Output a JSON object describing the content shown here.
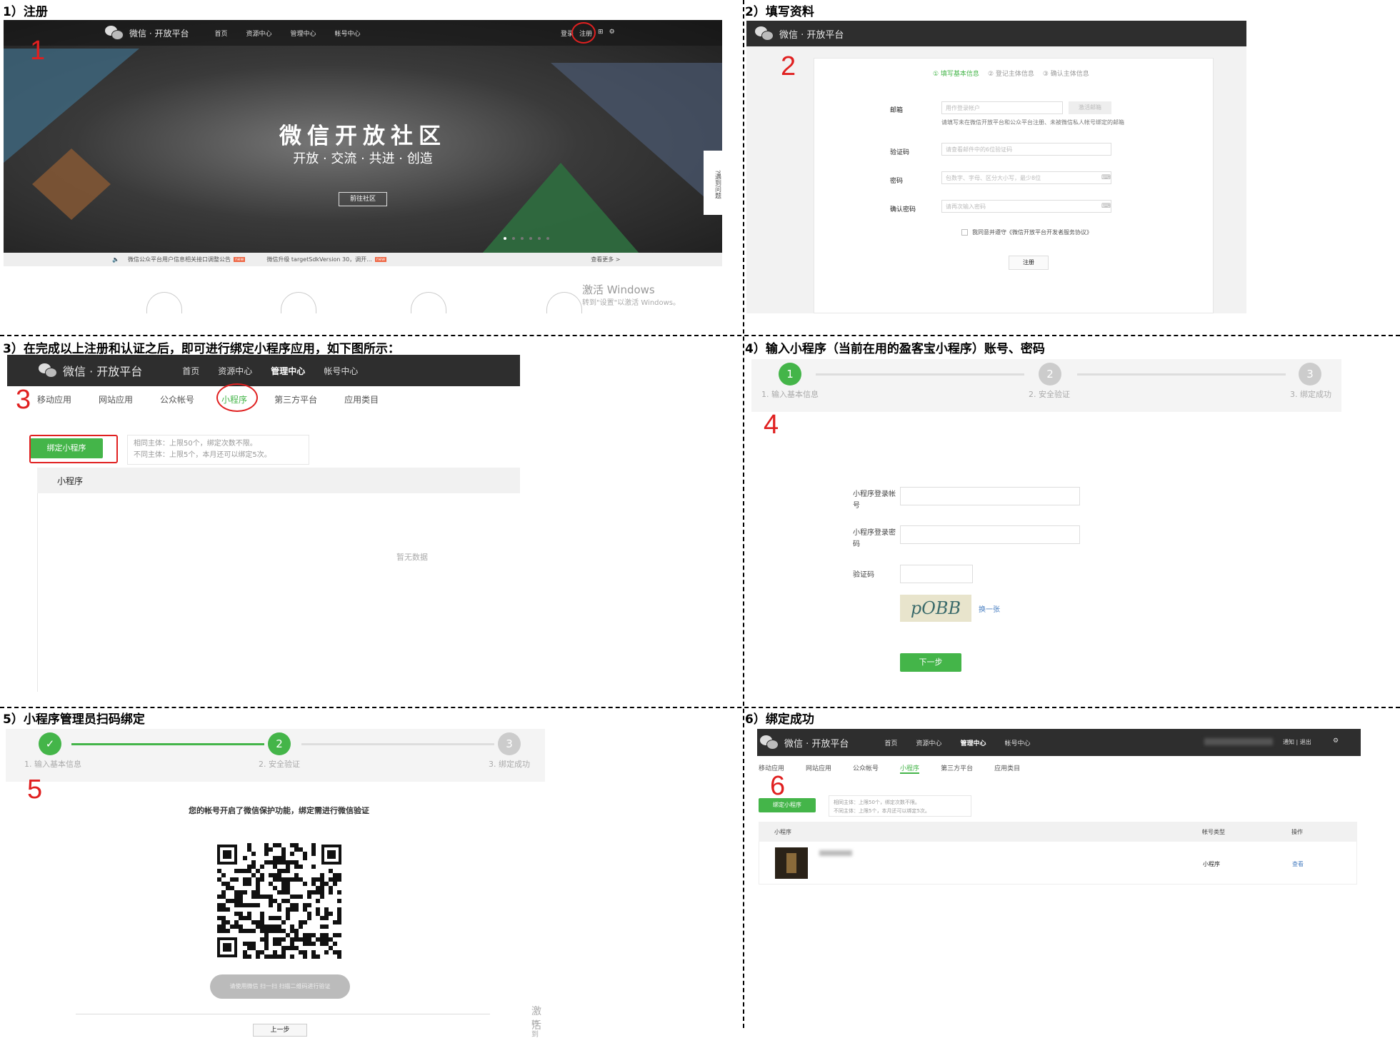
{
  "captions": {
    "c1": "1）注册",
    "c2": "2）填写资料",
    "c3": "3）在完成以上注册和认证之后，即可进行绑定小程序应用，如下图所示：",
    "c4": "4）输入小程序（当前在用的盈客宝小程序）账号、密码",
    "c5": "5）小程序管理员扫码绑定",
    "c6": "6）绑定成功"
  },
  "markers": {
    "m1": "1",
    "m2": "2",
    "m3": "3",
    "m4": "4",
    "m5": "5",
    "m6": "6"
  },
  "brand": "微信 · 开放平台",
  "nav": {
    "home": "首页",
    "resources": "资源中心",
    "manage": "管理中心",
    "account": "帐号中心"
  },
  "shot1": {
    "login": "登录",
    "register": "注册",
    "hero_title": "微信开放社区",
    "hero_sub": "开放 · 交流 · 共进 · 创造",
    "hero_btn": "前往社区",
    "notice1": "微信公众平台用户信息相关接口调整公告",
    "notice2": "微信升级 targetSdkVersion 30，调开...",
    "more": "查看更多 >",
    "side": "遇到问题",
    "new_badge": "new",
    "win1": "激活 Windows",
    "win2": "转到\"设置\"以激活 Windows。"
  },
  "shot2": {
    "steps": [
      "① 填写基本信息",
      "② 登记主体信息",
      "③ 确认主体信息"
    ],
    "email_label": "邮箱",
    "email_ph": "用作登录帐户",
    "activate": "激活邮箱",
    "email_hint": "请填写未在微信开放平台和公众平台注册、未被微信私人帐号绑定的邮箱",
    "code_label": "验证码",
    "code_ph": "请查看邮件中的6位验证码",
    "pwd_label": "密码",
    "pwd_ph": "包数字、字母、区分大小写，最少8位",
    "pwd2_label": "确认密码",
    "pwd2_ph": "请再次输入密码",
    "agree": "我同意并遵守《微信开放平台开发者服务协议》",
    "submit": "注册"
  },
  "shot3": {
    "tabs": [
      "移动应用",
      "网站应用",
      "公众帐号",
      "小程序",
      "第三方平台",
      "应用类目"
    ],
    "bind_btn": "绑定小程序",
    "rule1": "相同主体：上限50个，绑定次数不限。",
    "rule2": "不同主体：上限5个，本月还可以绑定5次。",
    "table_head": "小程序",
    "empty": "暂无数据"
  },
  "shot4": {
    "step_nums": [
      "1",
      "2",
      "3"
    ],
    "step_labels": [
      "1. 输入基本信息",
      "2. 安全验证",
      "3. 绑定成功"
    ],
    "acct_label": "小程序登录帐号",
    "pwd_label": "小程序登录密码",
    "code_label": "验证码",
    "captcha": "pOBB",
    "refresh": "换一张",
    "next": "下一步"
  },
  "shot5": {
    "step_nums": [
      "✓",
      "2",
      "3"
    ],
    "step_labels": [
      "1. 输入基本信息",
      "2. 安全验证",
      "3. 绑定成功"
    ],
    "notice": "您的帐号开启了微信保护功能，绑定需进行微信验证",
    "scan_tip": "请使用微信 扫一扫 扫描二维码进行验证",
    "back": "上一步",
    "win": "激活",
    "win2": "转到"
  },
  "shot6": {
    "user_area": "通知 | 退出",
    "tabs": [
      "移动应用",
      "网站应用",
      "公众帐号",
      "小程序",
      "第三方平台",
      "应用类目"
    ],
    "bind_btn": "绑定小程序",
    "rule1": "相同主体：上限50个，绑定次数不限。",
    "rule2": "不同主体：上限5个，本月还可以绑定5次。",
    "col1": "小程序",
    "col2": "帐号类型",
    "col3": "操作",
    "row_type": "小程序",
    "row_action": "查看"
  },
  "colors": {
    "green": "#44b549",
    "red": "#e02020",
    "dark": "#2e2e2e"
  }
}
